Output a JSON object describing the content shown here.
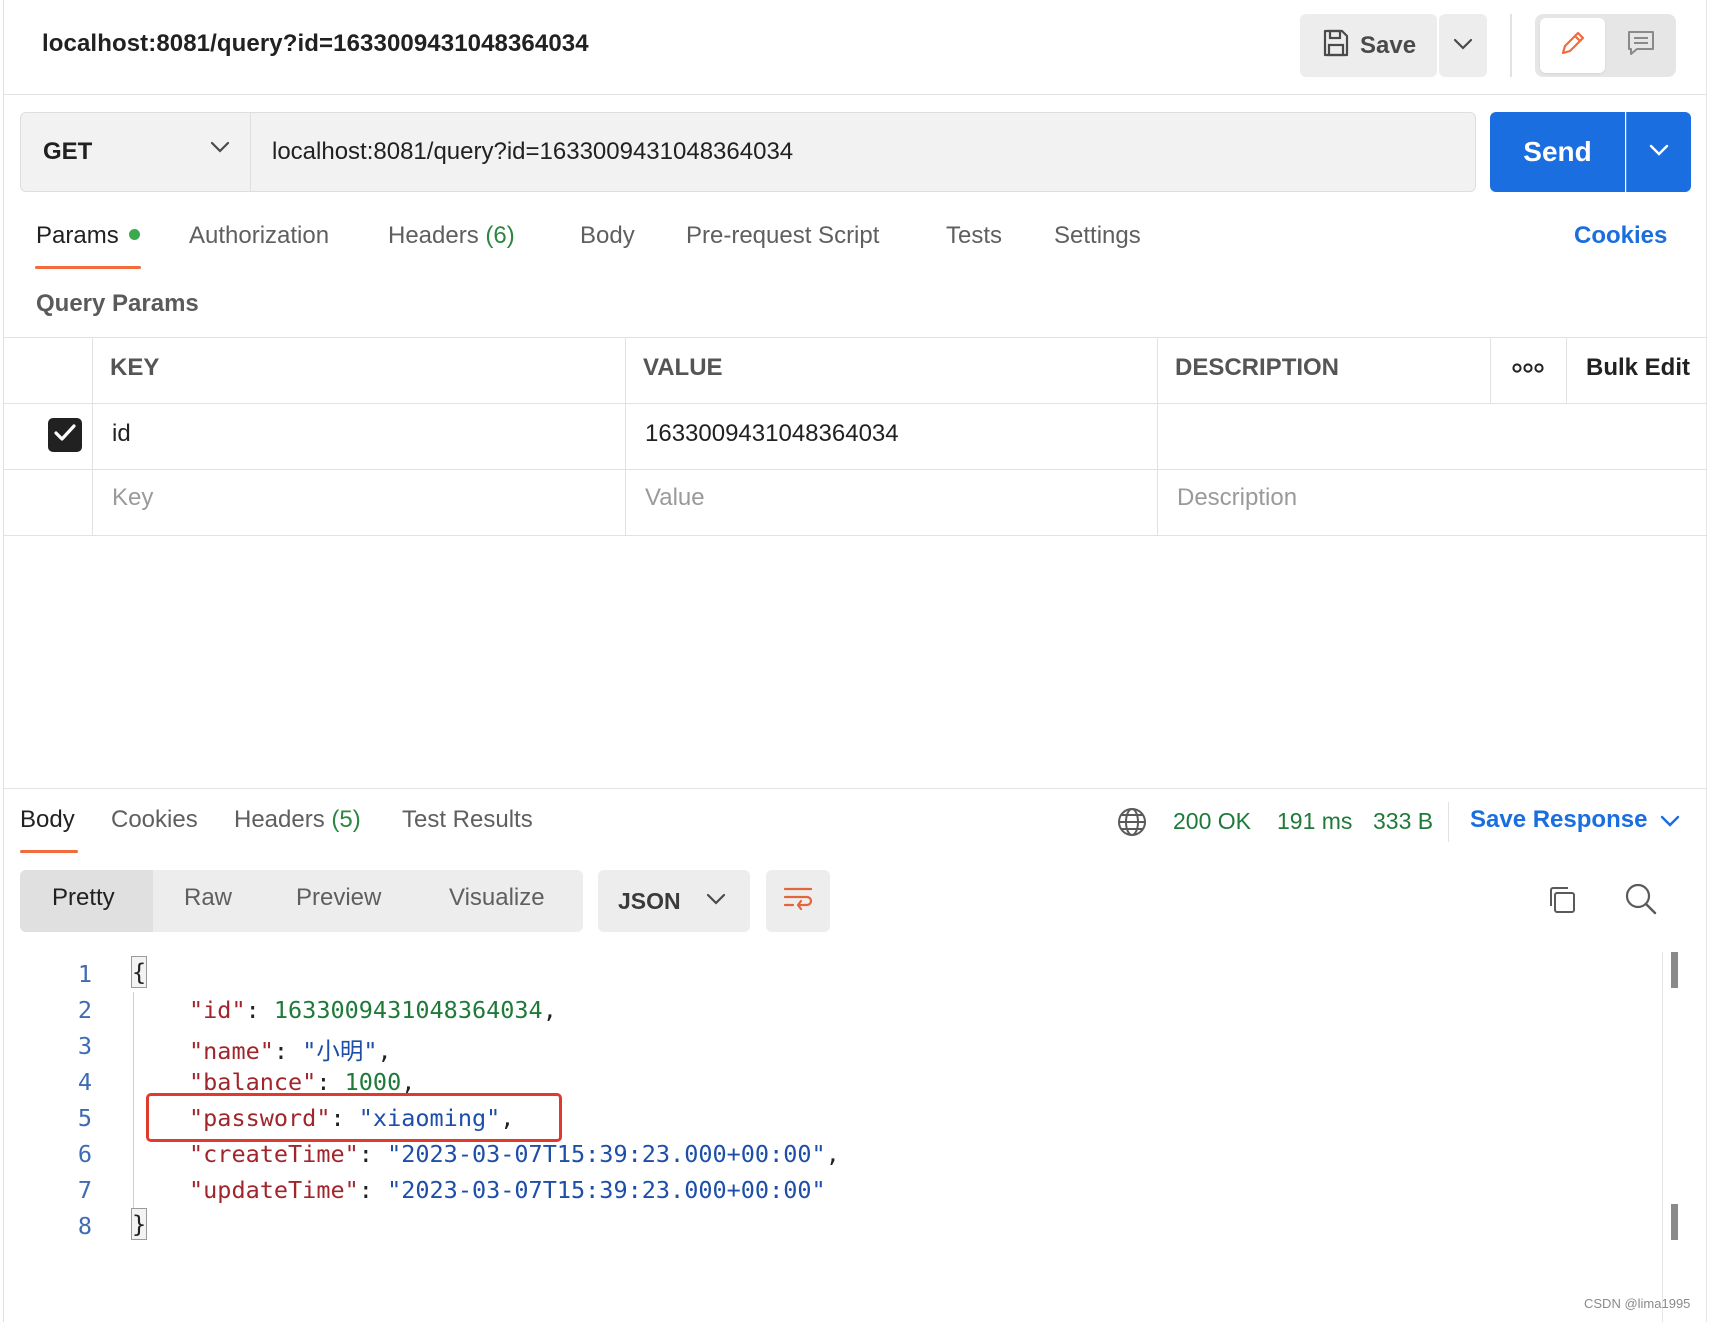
{
  "title_bar": {
    "tab_title": "localhost:8081/query?id=1633009431048364034",
    "save_label": "Save"
  },
  "request": {
    "method": "GET",
    "url": "localhost:8081/query?id=1633009431048364034",
    "send_label": "Send"
  },
  "request_tabs": [
    {
      "label": "Params",
      "active": true,
      "dot": true
    },
    {
      "label": "Authorization"
    },
    {
      "label": "Headers",
      "count": "(6)"
    },
    {
      "label": "Body"
    },
    {
      "label": "Pre-request Script"
    },
    {
      "label": "Tests"
    },
    {
      "label": "Settings"
    }
  ],
  "cookies_label": "Cookies",
  "query_params": {
    "title": "Query Params",
    "headers": {
      "key": "KEY",
      "value": "VALUE",
      "description": "DESCRIPTION",
      "bulk_edit": "Bulk Edit"
    },
    "rows": [
      {
        "checked": true,
        "key": "id",
        "value": "1633009431048364034",
        "description": ""
      }
    ],
    "placeholders": {
      "key": "Key",
      "value": "Value",
      "description": "Description"
    }
  },
  "response_tabs": [
    {
      "label": "Body",
      "active": true
    },
    {
      "label": "Cookies"
    },
    {
      "label": "Headers",
      "count": "(5)"
    },
    {
      "label": "Test Results"
    }
  ],
  "response_status": {
    "status": "200 OK",
    "time": "191 ms",
    "size": "333 B",
    "save_response": "Save Response"
  },
  "view_modes": [
    "Pretty",
    "Raw",
    "Preview",
    "Visualize"
  ],
  "active_view_mode": "Pretty",
  "format": "JSON",
  "code": {
    "line_numbers": [
      "1",
      "2",
      "3",
      "4",
      "5",
      "6",
      "7",
      "8"
    ],
    "open_brace": "{",
    "close_brace": "}",
    "fields": [
      {
        "key": "\"id\"",
        "value": "1633009431048364034",
        "type": "number",
        "comma": ","
      },
      {
        "key": "\"name\"",
        "value": "\"小明\"",
        "type": "string",
        "comma": ","
      },
      {
        "key": "\"balance\"",
        "value": "1000",
        "type": "number",
        "comma": ","
      },
      {
        "key": "\"password\"",
        "value": "\"xiaoming\"",
        "type": "string",
        "comma": ","
      },
      {
        "key": "\"createTime\"",
        "value": "\"2023-03-07T15:39:23.000+00:00\"",
        "type": "string",
        "comma": ","
      },
      {
        "key": "\"updateTime\"",
        "value": "\"2023-03-07T15:39:23.000+00:00\"",
        "type": "string",
        "comma": ""
      }
    ]
  },
  "watermark": "CSDN @lima1995",
  "colors": {
    "accent": "#1a6ee0",
    "tab_underline": "#f26b3a",
    "status_ok": "#1f7a3a",
    "highlight": "#e03a2e"
  },
  "icons": [
    "save-icon",
    "chevron-down-icon",
    "pencil-icon",
    "comment-icon",
    "more-icon",
    "check-icon",
    "globe-icon",
    "wrap-lines-icon",
    "copy-icon",
    "search-icon"
  ]
}
